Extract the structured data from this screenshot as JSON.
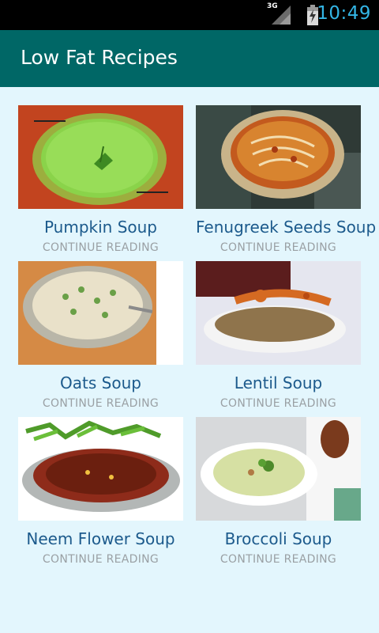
{
  "status_bar": {
    "network": "3G",
    "time": "10:49"
  },
  "app_bar": {
    "title": "Low Fat Recipes"
  },
  "recipes": [
    {
      "name": "Pumpkin Soup",
      "action": "CONTINUE READING",
      "image_icon": "pumpkin-soup-photo"
    },
    {
      "name": "Fenugreek Seeds Soup",
      "action": "CONTINUE READING",
      "image_icon": "fenugreek-soup-photo"
    },
    {
      "name": "Oats Soup",
      "action": "CONTINUE READING",
      "image_icon": "oats-soup-photo"
    },
    {
      "name": "Lentil Soup",
      "action": "CONTINUE READING",
      "image_icon": "lentil-soup-photo"
    },
    {
      "name": "Neem Flower Soup",
      "action": "CONTINUE READING",
      "image_icon": "neem-flower-soup-photo"
    },
    {
      "name": "Broccoli Soup",
      "action": "CONTINUE READING",
      "image_icon": "broccoli-soup-photo"
    }
  ],
  "colors": {
    "status_bar": "#000000",
    "app_bar": "#006766",
    "background": "#e3f6fd",
    "recipe_title": "#1c5a8c",
    "action_text": "#9aa0a4"
  }
}
